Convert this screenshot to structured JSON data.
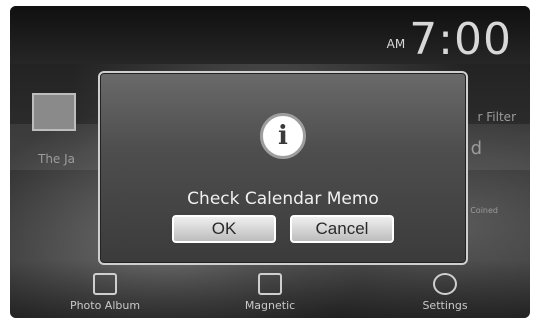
{
  "status_bar": {
    "ampm": "AM",
    "time": "7:00"
  },
  "background": {
    "left_label": "The Ja",
    "right_label": "r Filter",
    "right_small": "Coined",
    "right_mid": "d"
  },
  "dock": {
    "items": [
      {
        "label": "Photo Album"
      },
      {
        "label": "Magnetic"
      },
      {
        "label": "Settings"
      }
    ]
  },
  "dialog": {
    "icon": "info-icon",
    "message": "Check Calendar Memo",
    "ok_label": "OK",
    "cancel_label": "Cancel"
  }
}
